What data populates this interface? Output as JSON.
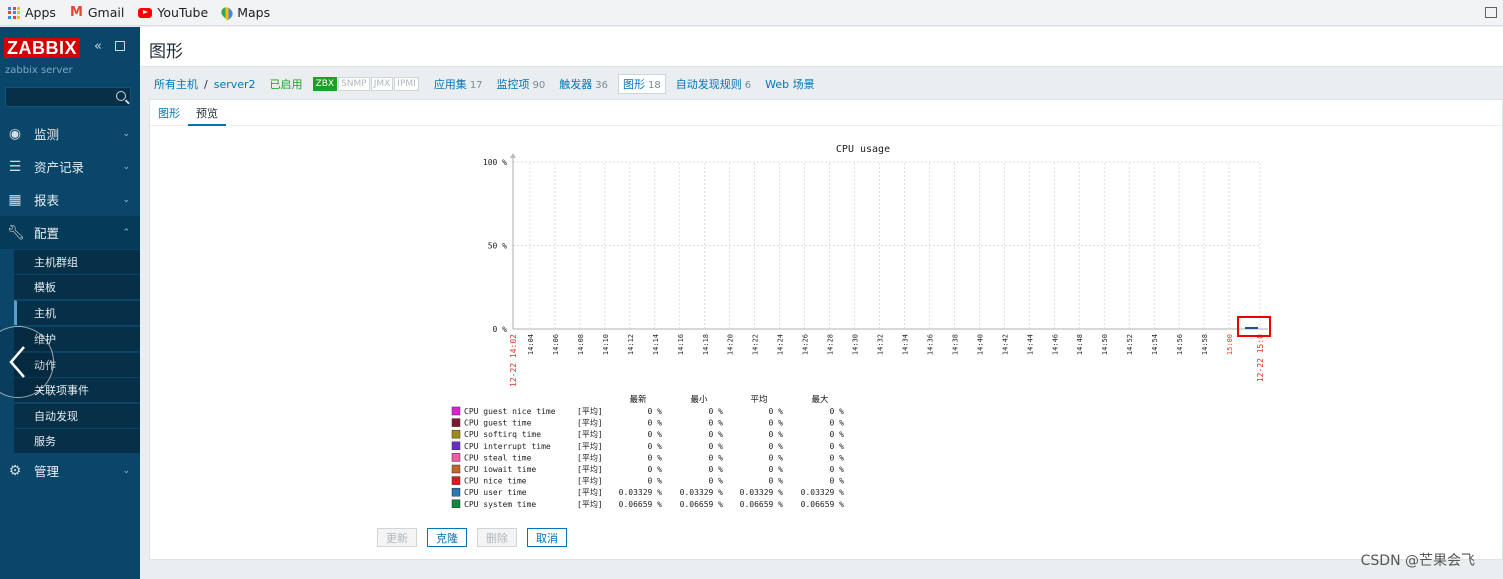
{
  "bookmarks": {
    "apps": "Apps",
    "gmail": "Gmail",
    "youtube": "YouTube",
    "maps": "Maps"
  },
  "sidebar": {
    "logo": "ZABBIX",
    "server": "zabbix server",
    "menu": [
      {
        "label": "监测",
        "icon": "eye-icon"
      },
      {
        "label": "资产记录",
        "icon": "list-icon"
      },
      {
        "label": "报表",
        "icon": "report-icon"
      },
      {
        "label": "配置",
        "icon": "wrench-icon"
      },
      {
        "label": "管理",
        "icon": "gear-icon"
      }
    ],
    "submenu": [
      "主机群组",
      "模板",
      "主机",
      "维护",
      "动作",
      "关联项事件",
      "自动发现",
      "服务"
    ]
  },
  "page": {
    "title": "图形"
  },
  "nav": {
    "all_hosts": "所有主机",
    "sep": "/",
    "host": "server2",
    "enabled": "已启用",
    "zbx": "ZBX",
    "snmp": "SNMP",
    "jmx": "JMX",
    "ipmi": "IPMI",
    "apps": "应用集",
    "apps_n": "17",
    "items": "监控项",
    "items_n": "90",
    "triggers": "触发器",
    "triggers_n": "36",
    "graphs": "图形",
    "graphs_n": "18",
    "discovery": "自动发现规则",
    "discovery_n": "6",
    "web": "Web 场景"
  },
  "tabs": {
    "graph": "图形",
    "preview": "预览"
  },
  "chart_data": {
    "type": "line",
    "title": "CPU usage",
    "ylabel": "",
    "xlabel": "",
    "ylim": [
      0,
      100
    ],
    "y_ticks": [
      "100 %",
      "50 %",
      "0 %"
    ],
    "x_start": "12-22 14:02",
    "x_end": "12-22 15:0",
    "x_ticks": [
      "14:04",
      "14:06",
      "14:08",
      "14:10",
      "14:12",
      "14:14",
      "14:16",
      "14:18",
      "14:20",
      "14:22",
      "14:24",
      "14:26",
      "14:28",
      "14:30",
      "14:32",
      "14:34",
      "14:36",
      "14:38",
      "14:40",
      "14:42",
      "14:44",
      "14:46",
      "14:48",
      "14:50",
      "14:52",
      "14:54",
      "14:56",
      "14:58",
      "15:00"
    ],
    "legend_header": [
      "最新",
      "最小",
      "平均",
      "最大"
    ],
    "series": [
      {
        "name": "CPU guest nice time",
        "color": "#e01fd0",
        "func": "[平均]",
        "last": "0 %",
        "min": "0 %",
        "avg": "0 %",
        "max": "0 %"
      },
      {
        "name": "CPU guest time",
        "color": "#7a1a33",
        "func": "[平均]",
        "last": "0 %",
        "min": "0 %",
        "avg": "0 %",
        "max": "0 %"
      },
      {
        "name": "CPU softirq time",
        "color": "#a18b1a",
        "func": "[平均]",
        "last": "0 %",
        "min": "0 %",
        "avg": "0 %",
        "max": "0 %"
      },
      {
        "name": "CPU interrupt time",
        "color": "#6a2cc7",
        "func": "[平均]",
        "last": "0 %",
        "min": "0 %",
        "avg": "0 %",
        "max": "0 %"
      },
      {
        "name": "CPU steal time",
        "color": "#f25ca8",
        "func": "[平均]",
        "last": "0 %",
        "min": "0 %",
        "avg": "0 %",
        "max": "0 %"
      },
      {
        "name": "CPU iowait time",
        "color": "#c0662a",
        "func": "[平均]",
        "last": "0 %",
        "min": "0 %",
        "avg": "0 %",
        "max": "0 %"
      },
      {
        "name": "CPU nice time",
        "color": "#e8161b",
        "func": "[平均]",
        "last": "0 %",
        "min": "0 %",
        "avg": "0 %",
        "max": "0 %"
      },
      {
        "name": "CPU user time",
        "color": "#2a78b0",
        "func": "[平均]",
        "last": "0.03329 %",
        "min": "0.03329 %",
        "avg": "0.03329 %",
        "max": "0.03329 %"
      },
      {
        "name": "CPU system time",
        "color": "#0e8a3a",
        "func": "[平均]",
        "last": "0.06659 %",
        "min": "0.06659 %",
        "avg": "0.06659 %",
        "max": "0.06659 %"
      }
    ]
  },
  "buttons": {
    "update": "更新",
    "clone": "克隆",
    "delete": "删除",
    "cancel": "取消"
  },
  "watermark": "CSDN @芒果会飞"
}
